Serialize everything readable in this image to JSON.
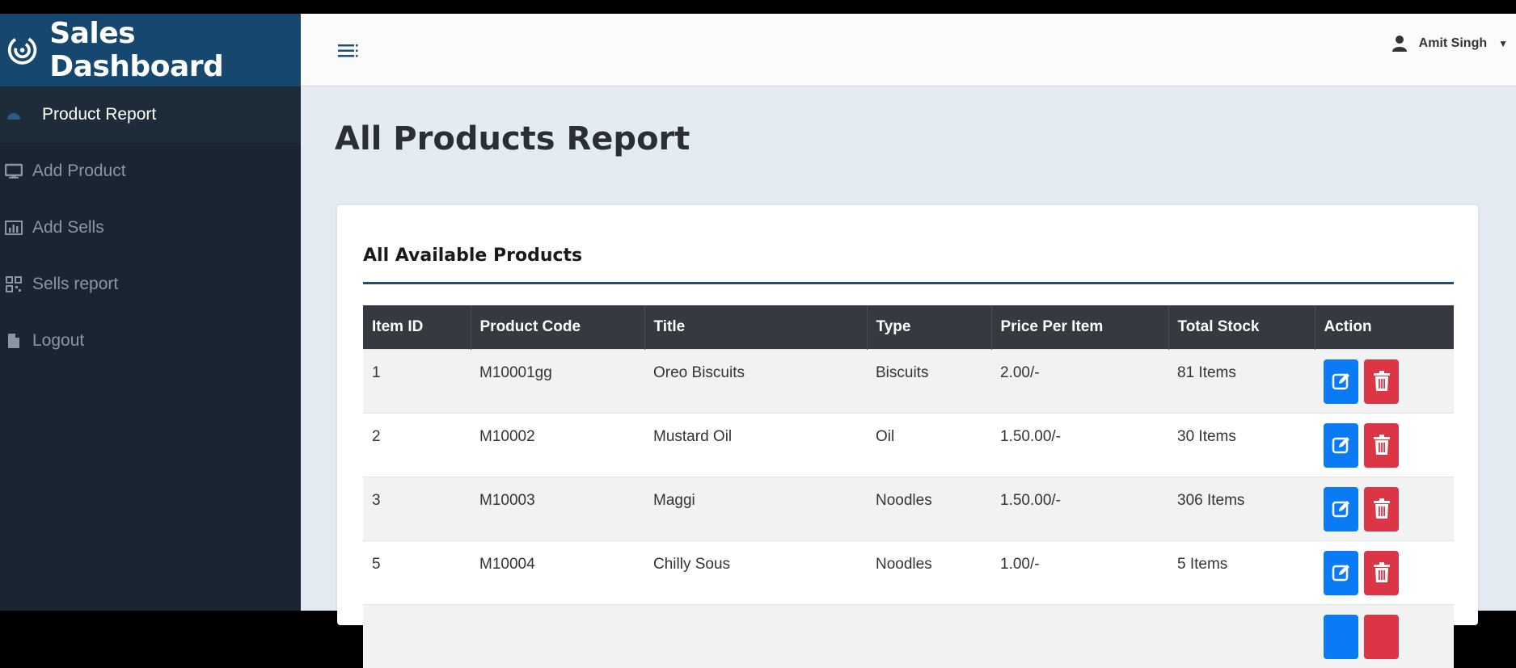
{
  "brand": {
    "title": "Sales Dashboard",
    "logo_icon": "power-ring-icon"
  },
  "sidebar": {
    "items": [
      {
        "label": "Product Report",
        "icon": "dashboard-icon",
        "active": true
      },
      {
        "label": "Add Product",
        "icon": "monitor-icon",
        "active": false
      },
      {
        "label": "Add Sells",
        "icon": "bar-chart-icon",
        "active": false
      },
      {
        "label": "Sells report",
        "icon": "qrcode-icon",
        "active": false
      },
      {
        "label": "Logout",
        "icon": "file-icon",
        "active": false
      }
    ]
  },
  "topbar": {
    "menu_icon": "menu-toggle-icon",
    "user_name": "Amit Singh",
    "user_icon": "user-icon",
    "caret_icon": "caret-down-icon"
  },
  "page": {
    "title": "All Products Report"
  },
  "card": {
    "title": "All Available Products",
    "columns": [
      "Item ID",
      "Product Code",
      "Title",
      "Type",
      "Price Per Item",
      "Total Stock",
      "Action"
    ],
    "rows": [
      {
        "id": "1",
        "code": "M10001gg",
        "title": "Oreo Biscuits",
        "type": "Biscuits",
        "price": "2.00/-",
        "stock": "81 Items"
      },
      {
        "id": "2",
        "code": "M10002",
        "title": "Mustard Oil",
        "type": "Oil",
        "price": "1.50.00/-",
        "stock": "30 Items"
      },
      {
        "id": "3",
        "code": "M10003",
        "title": "Maggi",
        "type": "Noodles",
        "price": "1.50.00/-",
        "stock": "306 Items"
      },
      {
        "id": "5",
        "code": "M10004",
        "title": "Chilly Sous",
        "type": "Noodles",
        "price": "1.00/-",
        "stock": "5 Items"
      },
      {
        "id": "",
        "code": "",
        "title": "",
        "type": "",
        "price": "",
        "stock": ""
      }
    ]
  },
  "colors": {
    "sidebar_bg": "#1a2531",
    "brand_bg": "#16486f",
    "edit_button": "#0a7bf5",
    "delete_button": "#dc3545",
    "table_header": "#343a40"
  }
}
